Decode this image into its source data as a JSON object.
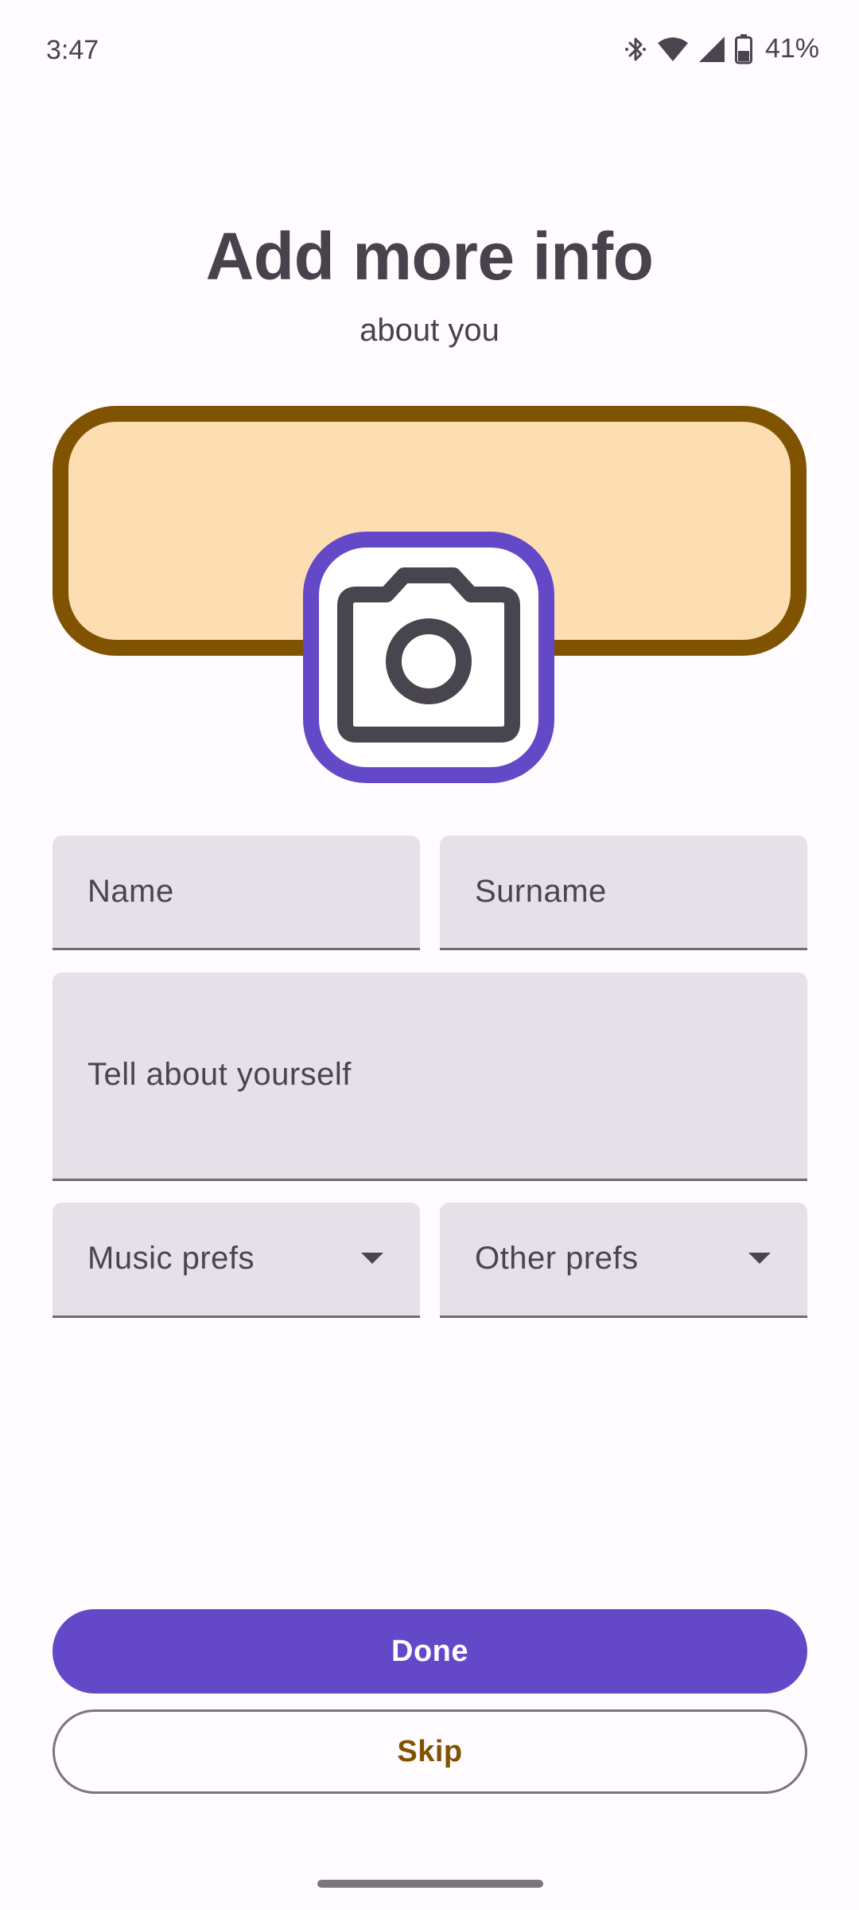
{
  "status_bar": {
    "time": "3:47",
    "battery": "41%",
    "icons": [
      "bluetooth-icon",
      "wifi-icon",
      "cell-signal-icon",
      "battery-icon"
    ]
  },
  "header": {
    "title": "Add more info",
    "subtitle": "about you"
  },
  "form": {
    "name_label": "Name",
    "surname_label": "Surname",
    "about_label": "Tell about yourself",
    "music_prefs_label": "Music prefs",
    "other_prefs_label": "Other prefs"
  },
  "actions": {
    "done_label": "Done",
    "skip_label": "Skip"
  },
  "colors": {
    "primary": "#6348C8",
    "cover_fill": "#FDDDB2",
    "cover_border": "#7F5300",
    "field_fill": "#E6E0E9",
    "skip_text": "#7F5300"
  }
}
